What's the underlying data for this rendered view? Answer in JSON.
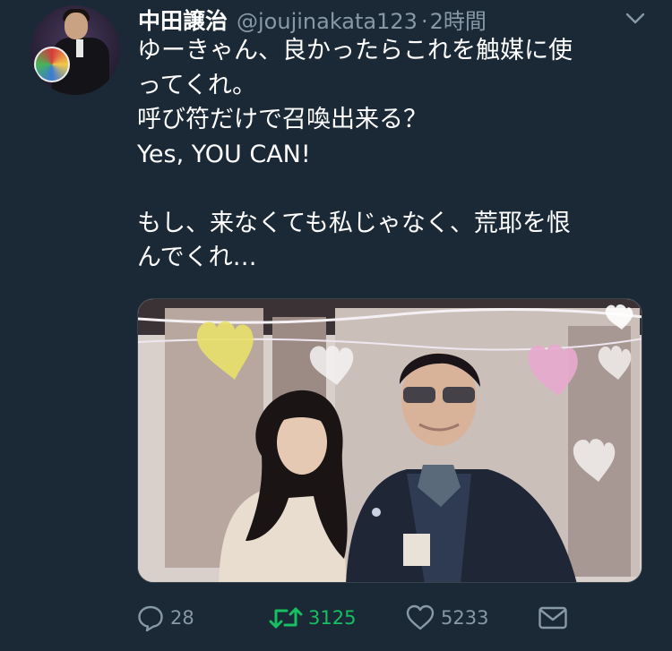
{
  "tweet": {
    "author_name": "中田譲治",
    "handle": "@joujinakata123",
    "separator": "·",
    "time": "2時間",
    "avatar_icon": "user-avatar",
    "caret_icon": "chevron-down-icon",
    "lines": [
      "ゆーきゃん、良かったらこれを触媒に使",
      "ってくれ。",
      "呼び符だけで召喚出来る？",
      "Yes, YOU CAN!",
      "",
      "もし、来なくても私じゃなく、荒耶を恨",
      "んでくれ…"
    ],
    "media_icon": "photo-image"
  },
  "actions": {
    "reply": {
      "icon": "reply-icon",
      "count": "28"
    },
    "retweet": {
      "icon": "retweet-icon",
      "count": "3125",
      "color": "#17bf63"
    },
    "like": {
      "icon": "heart-icon",
      "count": "5233"
    },
    "dm": {
      "icon": "envelope-icon"
    }
  },
  "colors": {
    "background": "#1b2836",
    "text": "#ffffff",
    "muted": "#8899a6",
    "retweet_active": "#17bf63"
  }
}
